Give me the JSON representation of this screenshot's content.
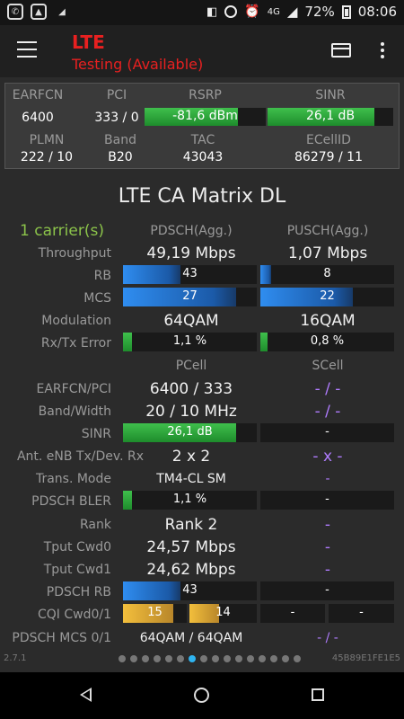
{
  "status": {
    "battery": "72%",
    "time": "08:06",
    "network": "4G"
  },
  "app": {
    "title": "LTE",
    "subtitle": "Testing (Available)"
  },
  "top": {
    "earfcn_label": "EARFCN",
    "earfcn": "6400",
    "pci_label": "PCI",
    "pci": "333 / 0",
    "rsrp_label": "RSRP",
    "rsrp": "-81,6 dBm",
    "rsrp_fill_pct": 77,
    "sinr_label": "SINR",
    "sinr": "26,1 dB",
    "sinr_fill_pct": 85,
    "plmn_label": "PLMN",
    "plmn": "222 / 10",
    "band_label": "Band",
    "band": "B20",
    "tac_label": "TAC",
    "tac": "43043",
    "ecellid_label": "ECellID",
    "ecellid": "86279 / 11"
  },
  "matrix": {
    "title": "LTE CA Matrix DL",
    "carriers": "1 carrier(s)",
    "pdsch_head": "PDSCH(Agg.)",
    "pusch_head": "PUSCH(Agg.)",
    "pcell_head": "PCell",
    "scell_head": "SCell",
    "labels": {
      "throughput": "Throughput",
      "rb": "RB",
      "mcs": "MCS",
      "modulation": "Modulation",
      "rxtx": "Rx/Tx Error",
      "earfcn_pci": "EARFCN/PCI",
      "band_width": "Band/Width",
      "sinr": "SINR",
      "ant": "Ant. eNB Tx/Dev. Rx",
      "trans": "Trans. Mode",
      "bler": "PDSCH BLER",
      "rank": "Rank",
      "tput0": "Tput Cwd0",
      "tput1": "Tput Cwd1",
      "pdsch_rb": "PDSCH RB",
      "cqi": "CQI Cwd0/1",
      "pdsch_mcs": "PDSCH MCS 0/1"
    },
    "throughput_dl": "49,19 Mbps",
    "throughput_ul": "1,07 Mbps",
    "rb_dl": "43",
    "rb_ul": "8",
    "mcs_dl": "27",
    "mcs_ul": "22",
    "mod_dl": "64QAM",
    "mod_ul": "16QAM",
    "err_dl": "1,1 %",
    "err_ul": "0,8 %",
    "earfcn_pci": "6400 / 333",
    "earfcn_pci_s": "- / -",
    "band_width": "20 / 10 MHz",
    "band_width_s": "- / -",
    "sinr": "26,1 dB",
    "sinr_s": "-",
    "ant": "2 x 2",
    "ant_s": "- x -",
    "trans": "TM4-CL SM",
    "trans_s": "-",
    "bler": "1,1 %",
    "bler_s": "-",
    "rank": "Rank 2",
    "rank_s": "-",
    "tput0": "24,57 Mbps",
    "tput0_s": "-",
    "tput1": "24,62 Mbps",
    "tput1_s": "-",
    "pdsch_rb": "43",
    "pdsch_rb_s": "-",
    "cqi0": "15",
    "cqi1": "14",
    "cqi_s0": "-",
    "cqi_s1": "-",
    "pdsch_mcs": "64QAM / 64QAM",
    "pdsch_mcs_s": "- / -"
  },
  "footer": {
    "version": "2.7.1",
    "id": "45B89E1FE1E5"
  },
  "pager": {
    "count": 16,
    "active": 6
  }
}
